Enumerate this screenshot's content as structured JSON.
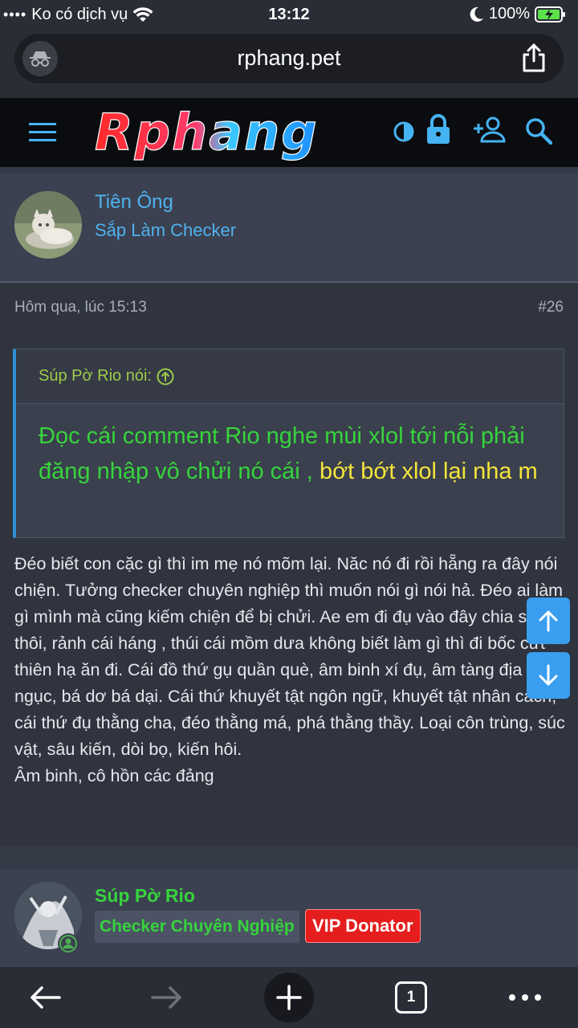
{
  "status_bar": {
    "carrier": "Ko có dịch vụ",
    "time": "13:12",
    "battery": "100%"
  },
  "browser": {
    "url": "rphang.pet",
    "tab_count": "1"
  },
  "site": {
    "logo_text": "Rphang"
  },
  "post1": {
    "username": "Tiên Ông",
    "user_title": "Sắp Làm Checker",
    "time": "Hôm qua, lúc 15:13",
    "post_number": "#26",
    "quote_attribution": "Súp Pờ Rio nói:",
    "quote_text_green": "Đọc cái comment Rio nghe mùi xlol tới nỗi phải đăng nhập vô chửi nó cái , ",
    "quote_text_yellow": "bớt bớt xlol lại nha m",
    "body_line1": "Đéo biết con cặc gì thì im mẹ nó mõm lại. Năc nó đi rồi hẵng ra đây nói chiện. Tưởng checker chuyên nghiệp thì muốn nói gì nói hả. Đéo ai làm gì mình mà cũng kiếm chiện để bị chửi. Ae em đi đụ vào đây chia sẽ thôi, rảnh cái háng , thúi cái mồm dưa không biết làm gì thì đi bốc cứt thiên hạ ăn đi. Cái đồ thứ gụ quần què, âm binh xí đụ, âm tàng địa ngục, bá dơ bá dại. Cái thứ khuyết tật ngôn ngữ, khuyết tật nhân cách, cái thứ đụ thằng cha, đéo thằng má, phá thằng thầy. Loại côn trùng, súc vật, sâu kiến, dòi bọ, kiến hôi.",
    "body_line2": "Âm binh, cô hồn các đảng"
  },
  "post2": {
    "username": "Súp Pờ Rio",
    "badge_title": "Checker Chuyên Nghiệp",
    "badge_vip": "VIP Donator"
  },
  "colors": {
    "accent_blue": "#4fb2ef",
    "quote_green": "#37d33d",
    "quote_yellow": "#f4e43c",
    "vip_red": "#e51d1d"
  }
}
